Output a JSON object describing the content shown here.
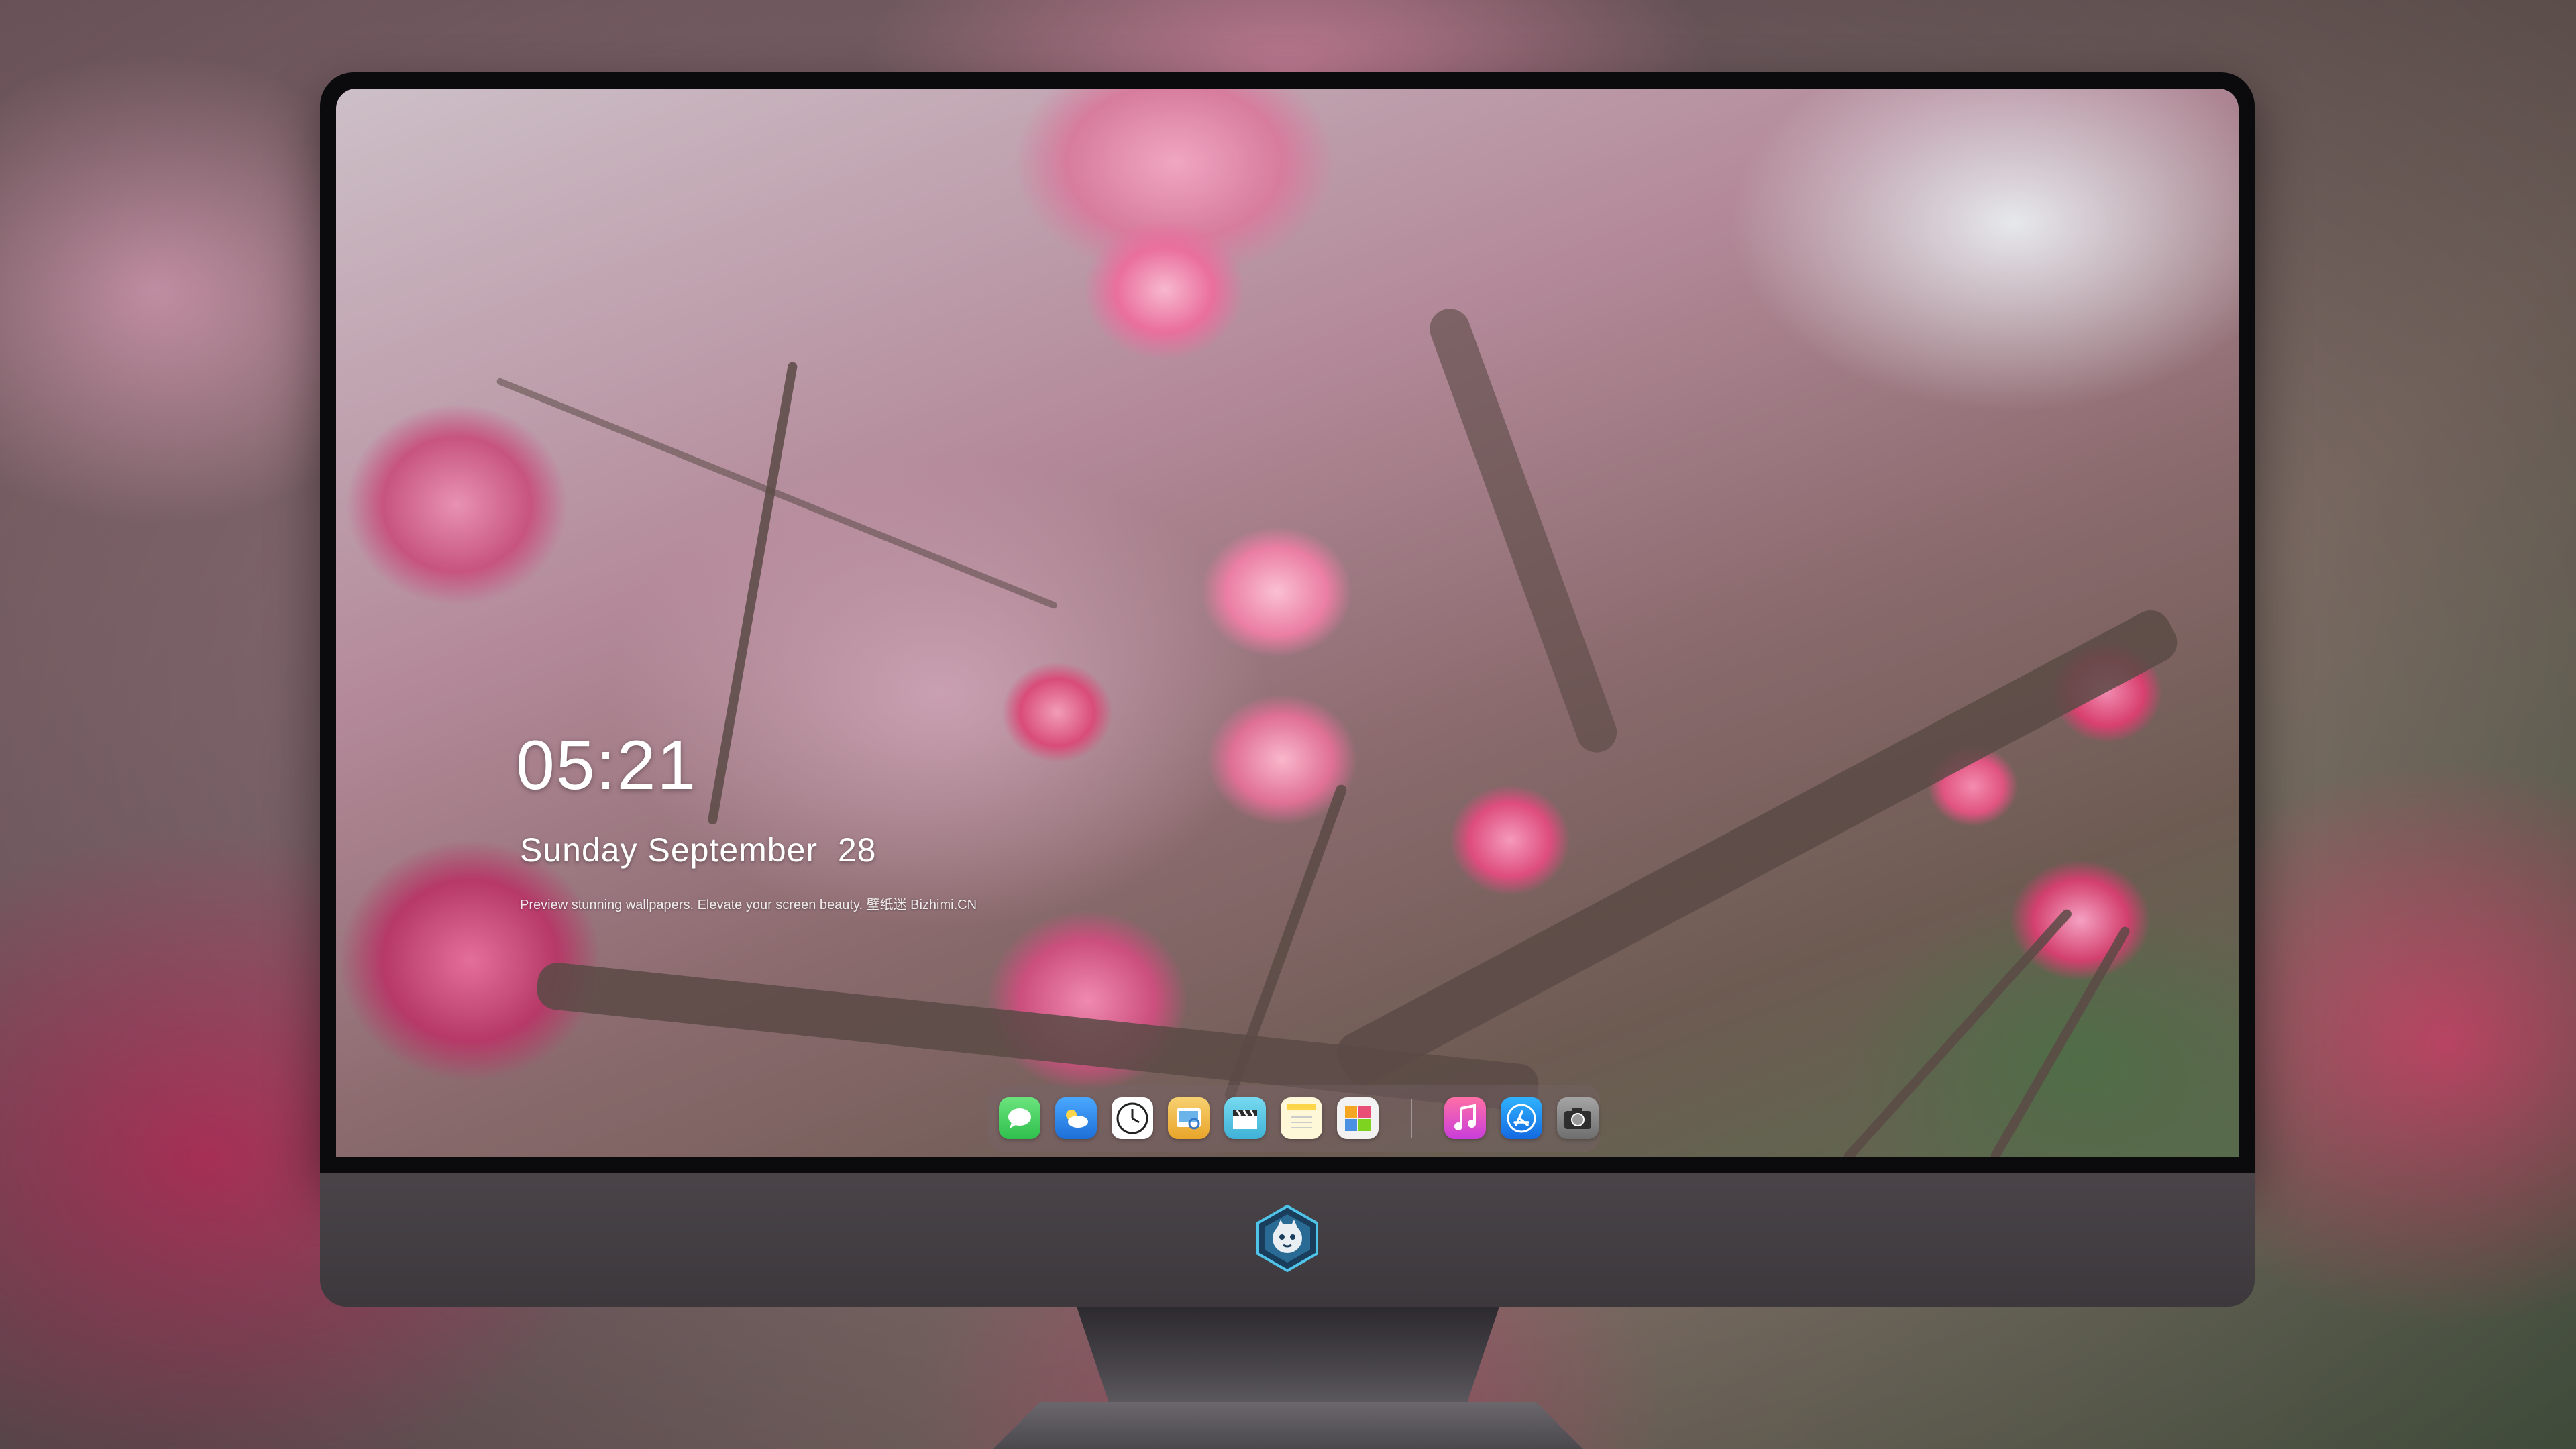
{
  "lock_screen": {
    "time": "05:21",
    "date": "Sunday September  28",
    "tagline": "Preview stunning wallpapers. Elevate your screen beauty. 壁纸迷 Bizhimi.CN"
  },
  "dock": {
    "apps": [
      {
        "name": "Messages",
        "icon": "messages-icon",
        "color": "#35c759"
      },
      {
        "name": "Weather",
        "icon": "weather-icon",
        "color": "#2f8ff0"
      },
      {
        "name": "Clock",
        "icon": "clock-icon",
        "color": "#ffffff"
      },
      {
        "name": "Preview",
        "icon": "preview-icon",
        "color": "#f2b632"
      },
      {
        "name": "Final Cut",
        "icon": "clapper-icon",
        "color": "#5cc8e6"
      },
      {
        "name": "Notes",
        "icon": "notes-icon",
        "color": "#ffd54a"
      },
      {
        "name": "Photos",
        "icon": "photos-icon",
        "color": "#e8e8e8"
      },
      {
        "name": "Music",
        "icon": "music-icon",
        "color": "#fb3a73"
      },
      {
        "name": "App Store",
        "icon": "app-store-icon",
        "color": "#1e8cf5"
      },
      {
        "name": "Camera",
        "icon": "camera-icon",
        "color": "#8b8b8b"
      }
    ]
  },
  "monitor": {
    "logo": "bizhimi-logo"
  }
}
